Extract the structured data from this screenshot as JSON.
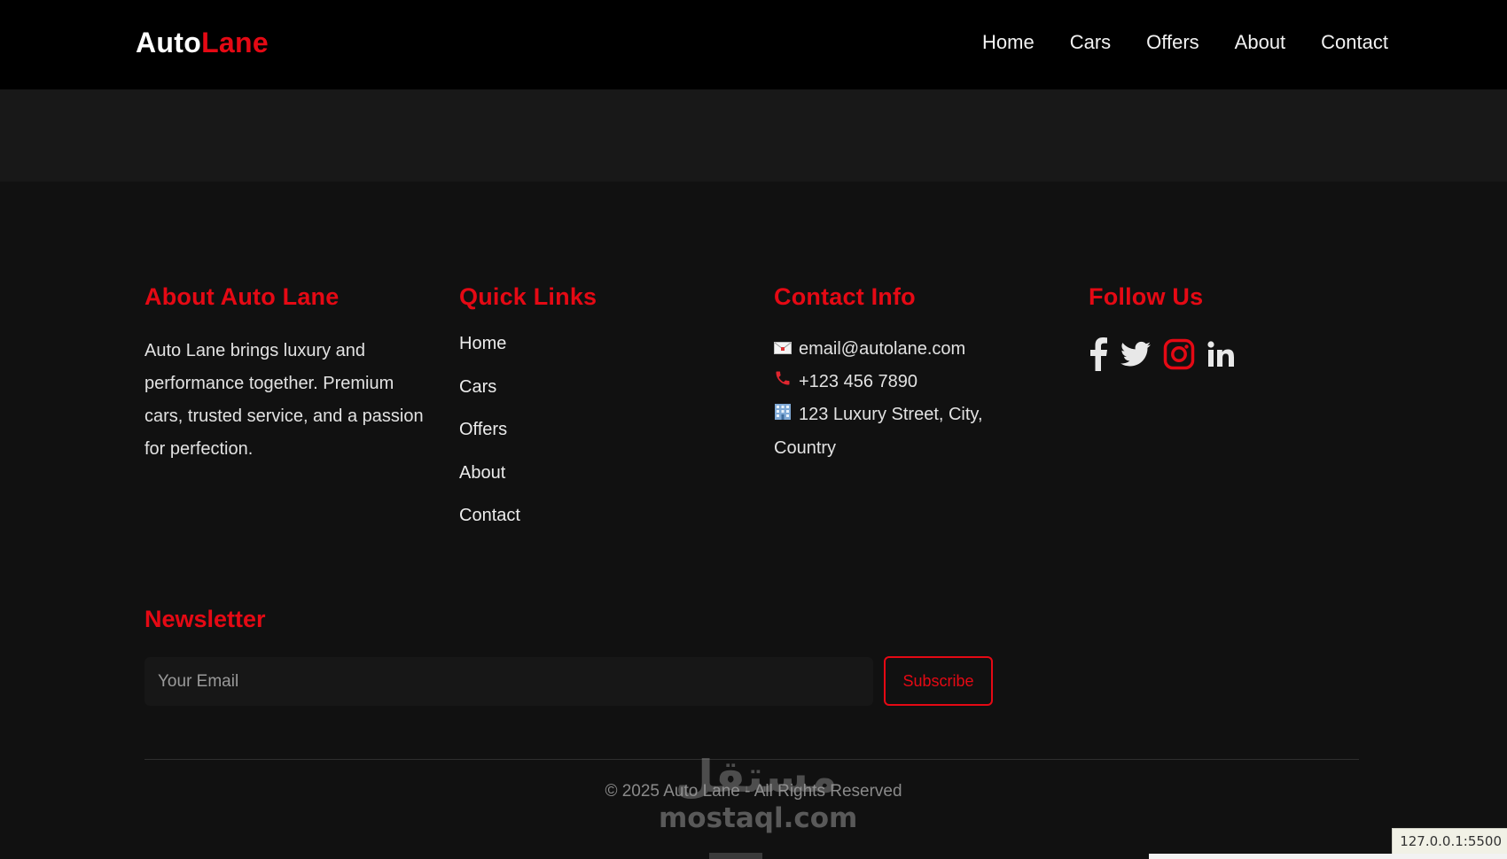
{
  "header": {
    "logo_primary": "Auto",
    "logo_accent": "Lane",
    "nav": [
      "Home",
      "Cars",
      "Offers",
      "About",
      "Contact"
    ]
  },
  "footer": {
    "about": {
      "title": "About Auto Lane",
      "text": "Auto Lane brings luxury and performance together. Premium cars, trusted service, and a passion for perfection."
    },
    "quick_links": {
      "title": "Quick Links",
      "items": [
        "Home",
        "Cars",
        "Offers",
        "About",
        "Contact"
      ]
    },
    "contact": {
      "title": "Contact Info",
      "email": "email@autolane.com",
      "phone": "+123 456 7890",
      "address": "123 Luxury Street, City, Country"
    },
    "follow": {
      "title": "Follow Us",
      "icons": [
        "facebook-icon",
        "twitter-icon",
        "instagram-icon",
        "linkedin-icon"
      ]
    },
    "newsletter": {
      "title": "Newsletter",
      "placeholder": "Your Email",
      "button": "Subscribe"
    },
    "copyright": "© 2025 Auto Lane - All Rights Reserved"
  },
  "watermark": {
    "arabic": "مستقل",
    "latin": "mostaql.com"
  },
  "status_bar": {
    "url": "127.0.0.1:5500"
  },
  "colors": {
    "accent": "#e50914",
    "background": "#111111",
    "header": "#000000"
  }
}
